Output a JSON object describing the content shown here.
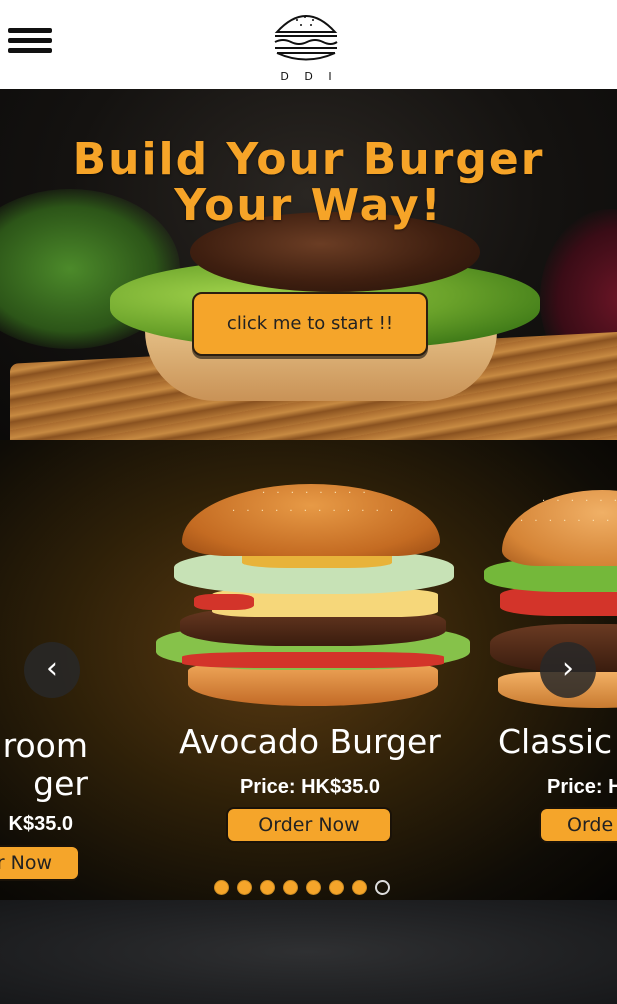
{
  "header": {
    "logo_text": "D D I"
  },
  "hero": {
    "title_line1": "Build Your Burger",
    "title_line2": "Your Way!",
    "start_button": "click me to start !!"
  },
  "carousel": {
    "slides": [
      {
        "name_line1": "room",
        "name_line2": "ger",
        "price": "K$35.0",
        "order": "r Now"
      },
      {
        "name": "Avocado Burger",
        "price": "Price: HK$35.0",
        "order": "Order Now"
      },
      {
        "name": "Classic",
        "price": "Price: H",
        "order": "Orde"
      }
    ],
    "prev_icon": "chevron-left-icon",
    "next_icon": "chevron-right-icon",
    "dots_total": 8,
    "active_dot_index": 7
  },
  "colors": {
    "accent": "#f5a52a",
    "title": "#f6a428"
  }
}
